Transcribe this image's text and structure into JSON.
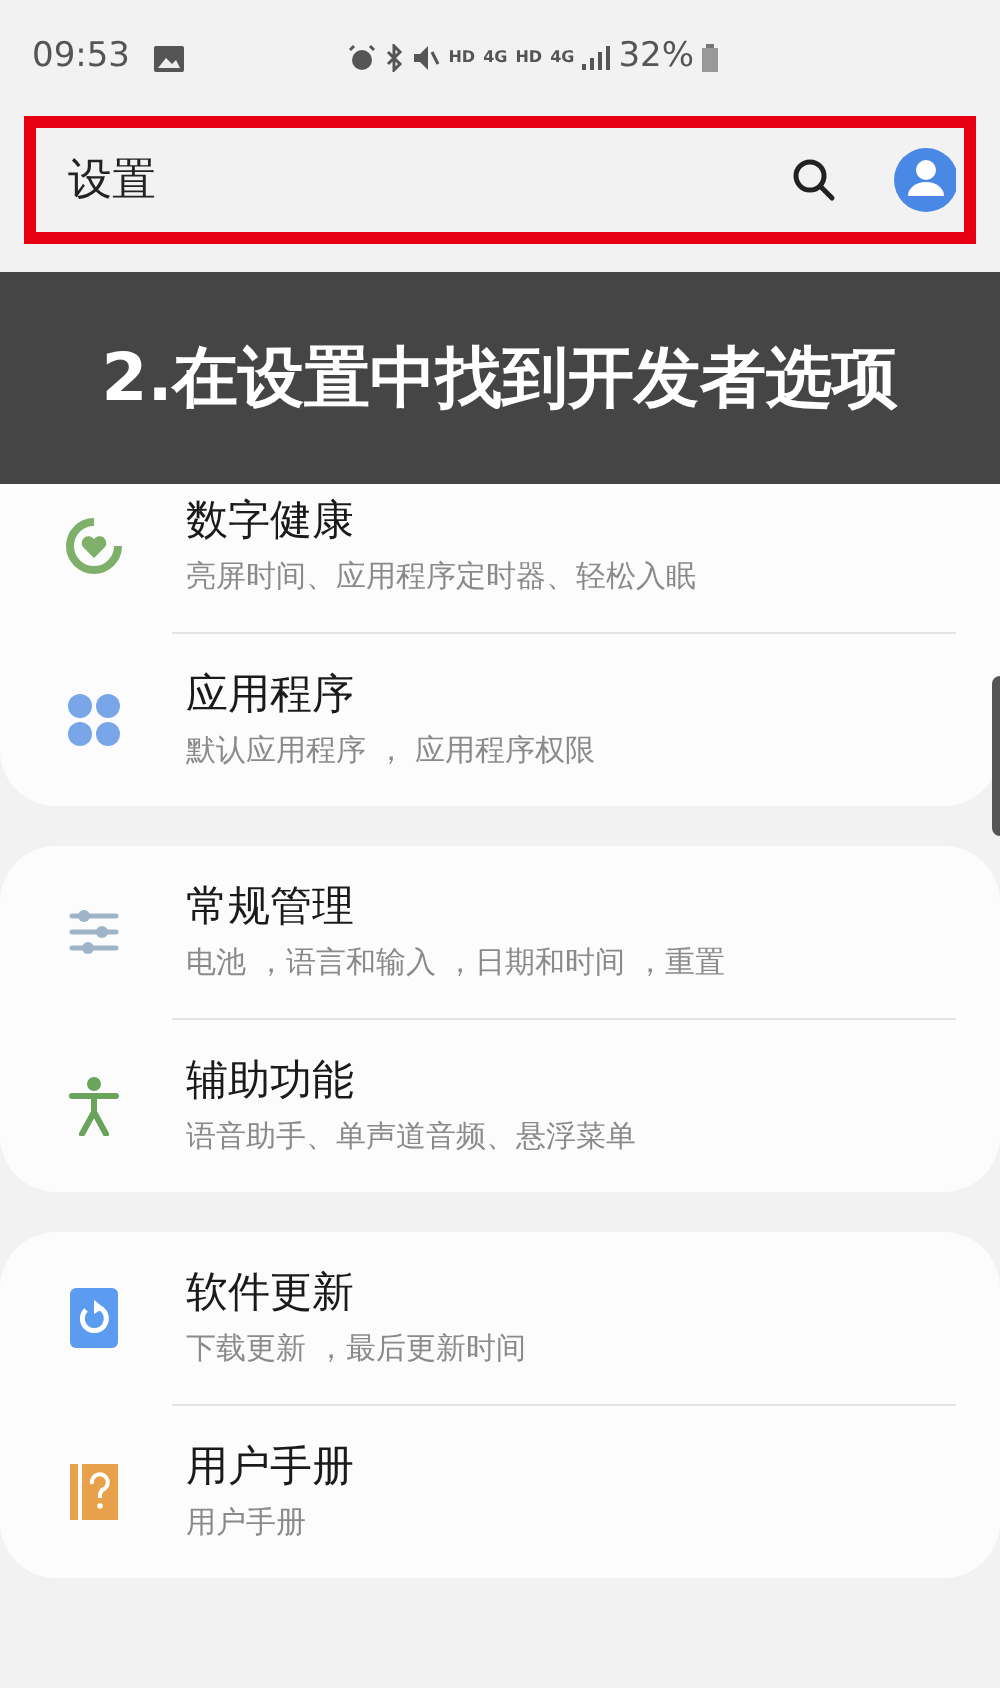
{
  "status_bar": {
    "time": "09:53",
    "indicators": [
      "HD",
      "4G",
      "HD",
      "4G"
    ],
    "battery": "32%"
  },
  "header": {
    "title": "设置",
    "highlighted": true
  },
  "banner": {
    "text": "2.在设置中找到开发者选项"
  },
  "groups": [
    {
      "items": [
        {
          "kind": "wellbeing",
          "title": "数字健康",
          "subtitle": "亮屏时间、应用程序定时器、轻松入眠"
        },
        {
          "kind": "apps",
          "title": "应用程序",
          "subtitle": "默认应用程序 ， 应用程序权限"
        }
      ]
    },
    {
      "items": [
        {
          "kind": "general",
          "title": "常规管理",
          "subtitle": "电池 ，语言和输入 ，日期和时间 ，重置"
        },
        {
          "kind": "accessibility",
          "title": "辅助功能",
          "subtitle": "语音助手、单声道音频、悬浮菜单"
        }
      ]
    },
    {
      "items": [
        {
          "kind": "update",
          "title": "软件更新",
          "subtitle": "下载更新 ，最后更新时间"
        },
        {
          "kind": "manual",
          "title": "用户手册",
          "subtitle": "用户手册"
        }
      ]
    }
  ]
}
